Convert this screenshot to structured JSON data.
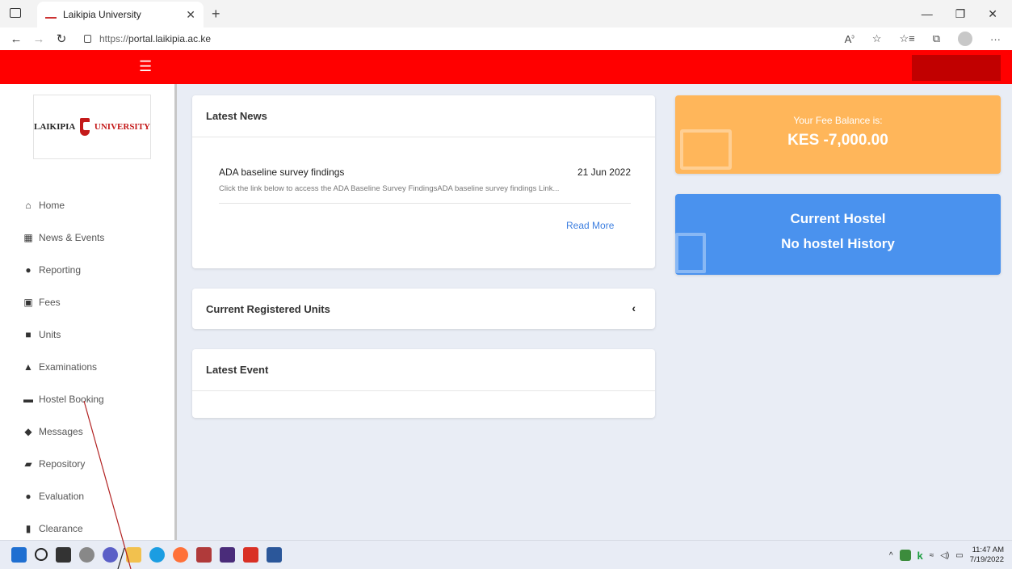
{
  "browser": {
    "tab_title": "Laikipia University",
    "url_protocol": "https://",
    "url_host": "portal.laikipia.ac.ke"
  },
  "header": {
    "menu_icon": "hamburger-icon"
  },
  "sidebar": {
    "logo_left": "LAIKIPIA",
    "logo_right": "UNIVERSITY",
    "items": [
      {
        "label": "Home",
        "icon": "home-icon"
      },
      {
        "label": "News & Events",
        "icon": "calendar-icon"
      },
      {
        "label": "Reporting",
        "icon": "clock-icon"
      },
      {
        "label": "Fees",
        "icon": "money-icon"
      },
      {
        "label": "Units",
        "icon": "book-icon"
      },
      {
        "label": "Examinations",
        "icon": "graduation-cap-icon"
      },
      {
        "label": "Hostel Booking",
        "icon": "bed-icon"
      },
      {
        "label": "Messages",
        "icon": "comments-icon"
      },
      {
        "label": "Repository",
        "icon": "folder-open-icon"
      },
      {
        "label": "Evaluation",
        "icon": "clock-icon"
      },
      {
        "label": "Clearance",
        "icon": "file-icon"
      }
    ]
  },
  "news": {
    "title": "Latest News",
    "item_title": "ADA baseline survey findings",
    "item_date": "21 Jun 2022",
    "item_desc": "Click the link below to access the ADA Baseline Survey FindingsADA baseline survey findings Link...",
    "read_more": "Read More"
  },
  "units": {
    "title": "Current Registered Units"
  },
  "event": {
    "title": "Latest Event"
  },
  "fee": {
    "label": "Your Fee Balance is:",
    "amount": "KES -7,000.00"
  },
  "hostel": {
    "line1": "Current Hostel",
    "line2": "No hostel History"
  },
  "taskbar": {
    "time": "11:47 AM",
    "date": "7/19/2022"
  },
  "colors": {
    "header_red": "#ff0000",
    "fee_orange": "#ffb65a",
    "hostel_blue": "#4a92ee",
    "link_blue": "#3d7fe0"
  }
}
